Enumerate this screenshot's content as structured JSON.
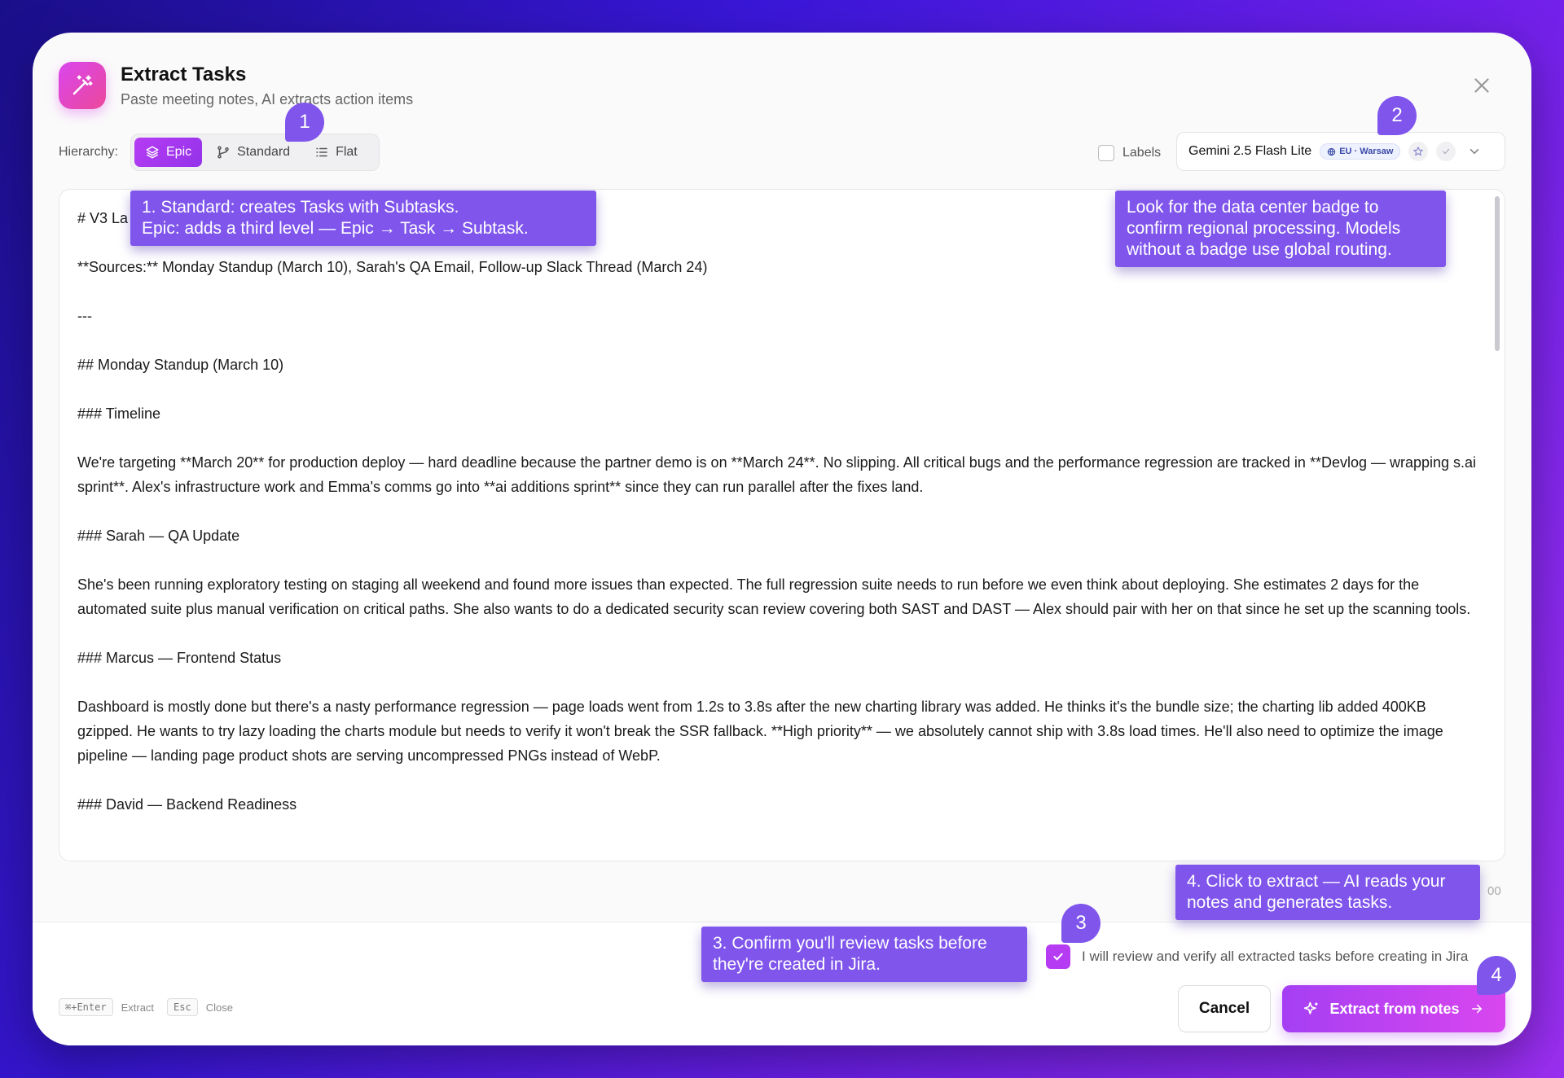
{
  "dialog": {
    "title": "Extract Tasks",
    "subtitle": "Paste meeting notes, AI extracts action items"
  },
  "hierarchy": {
    "label": "Hierarchy:",
    "options": [
      "Epic",
      "Standard",
      "Flat"
    ],
    "selected": "Epic"
  },
  "labels_toggle": {
    "label": "Labels",
    "checked": false
  },
  "model": {
    "name": "Gemini 2.5 Flash Lite",
    "region_badge": "EU · Warsaw"
  },
  "notes": {
    "text": "# V3 La\n\n**Sources:** Monday Standup (March 10), Sarah's QA Email, Follow-up Slack Thread (March 24)\n\n---\n\n## Monday Standup (March 10)\n\n### Timeline\n\nWe're targeting **March 20** for production deploy — hard deadline because the partner demo is on **March 24**. No slipping. All critical bugs and the performance regression are tracked in **Devlog — wrapping s.ai sprint**. Alex's infrastructure work and Emma's comms go into **ai additions sprint** since they can run parallel after the fixes land.\n\n### Sarah — QA Update\n\nShe's been running exploratory testing on staging all weekend and found more issues than expected. The full regression suite needs to run before we even think about deploying. She estimates 2 days for the automated suite plus manual verification on critical paths. She also wants to do a dedicated security scan review covering both SAST and DAST — Alex should pair with her on that since he set up the scanning tools.\n\n### Marcus — Frontend Status\n\nDashboard is mostly done but there's a nasty performance regression — page loads went from 1.2s to 3.8s after the new charting library was added. He thinks it's the bundle size; the charting lib added 400KB gzipped. He wants to try lazy loading the charts module but needs to verify it won't break the SSR fallback. **High priority** — we absolutely cannot ship with 3.8s load times. He'll also need to optimize the image pipeline — landing page product shots are serving uncompressed PNGs instead of WebP.\n\n### David — Backend Readiness",
    "char_count": "00"
  },
  "footer": {
    "review_confirm": "I will review and verify all extracted tasks before creating in Jira",
    "review_checked": true,
    "shortcuts": [
      {
        "key": "⌘+Enter",
        "label": "Extract"
      },
      {
        "key": "Esc",
        "label": "Close"
      }
    ],
    "cancel_label": "Cancel",
    "extract_label": "Extract from notes"
  },
  "annotations": {
    "tip1": "1. Standard: creates Tasks with Subtasks.\nEpic: adds a third  level — Epic → Task → Subtask.",
    "tip2": "Look for the data center badge to\nconfirm regional processing. Models\nwithout a badge use global routing.",
    "tip3": "3. Confirm you'll review tasks before\nthey're created in Jira.",
    "tip4": "4. Click to extract — AI reads your\nnotes and generates tasks.",
    "badges": [
      "1",
      "2",
      "3",
      "4"
    ]
  },
  "colors": {
    "accent": "#b63cf3",
    "annotation": "#7f55ec",
    "badge_bg": "#eef2ff"
  }
}
